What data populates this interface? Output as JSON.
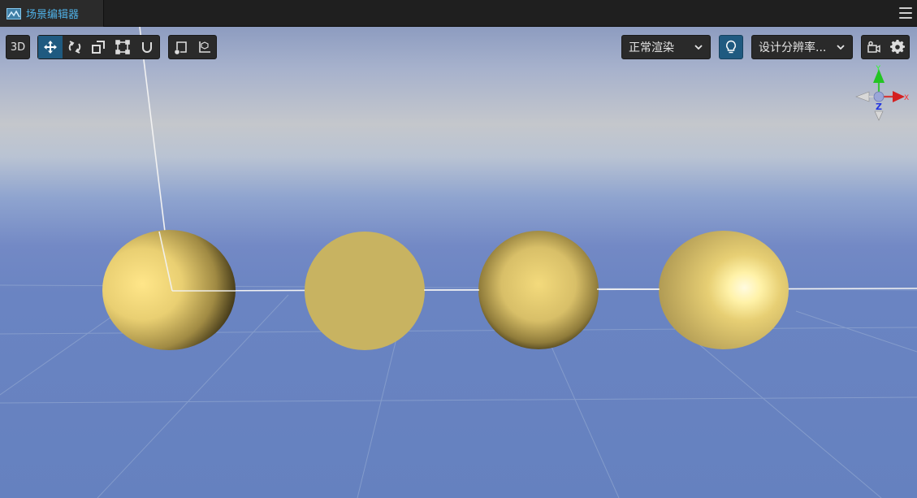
{
  "tab": {
    "title": "场景编辑器",
    "icon": "scene-editor-icon"
  },
  "menu": {
    "icon": "hamburger-menu-icon"
  },
  "toolbar": {
    "mode_label": "3D",
    "transform_tools": [
      {
        "name": "move-tool",
        "icon": "move-arrows-icon",
        "active": true
      },
      {
        "name": "rotate-tool",
        "icon": "rotate-icon",
        "active": false
      },
      {
        "name": "scale-tool",
        "icon": "scale-icon",
        "active": false
      },
      {
        "name": "rect-tool",
        "icon": "rect-transform-icon",
        "active": false
      },
      {
        "name": "snap-tool",
        "icon": "magnet-icon",
        "active": false
      }
    ],
    "pivot_tools": [
      {
        "name": "pivot-tool",
        "icon": "pivot-icon"
      },
      {
        "name": "coordinate-tool",
        "icon": "local-coordinate-icon"
      }
    ],
    "render_mode": "正常渲染",
    "light_toggle": {
      "icon": "lightbulb-icon",
      "active": true
    },
    "resolution": "设计分辨率...",
    "camera_icon": "camera-icon",
    "settings_icon": "gear-icon"
  },
  "gizmo": {
    "x_label": "X",
    "y_label": "Y",
    "z_label": "Z"
  },
  "scene": {
    "objects": [
      {
        "name": "sphere-1",
        "shading": "directional-lit"
      },
      {
        "name": "sphere-2",
        "shading": "unlit"
      },
      {
        "name": "sphere-3",
        "shading": "ambient-lit"
      },
      {
        "name": "sphere-4",
        "shading": "specular-lit"
      }
    ],
    "colors": {
      "sphere_base": "#c9b462",
      "highlight": "#fff2a8",
      "accent": "#1f5a80"
    }
  }
}
